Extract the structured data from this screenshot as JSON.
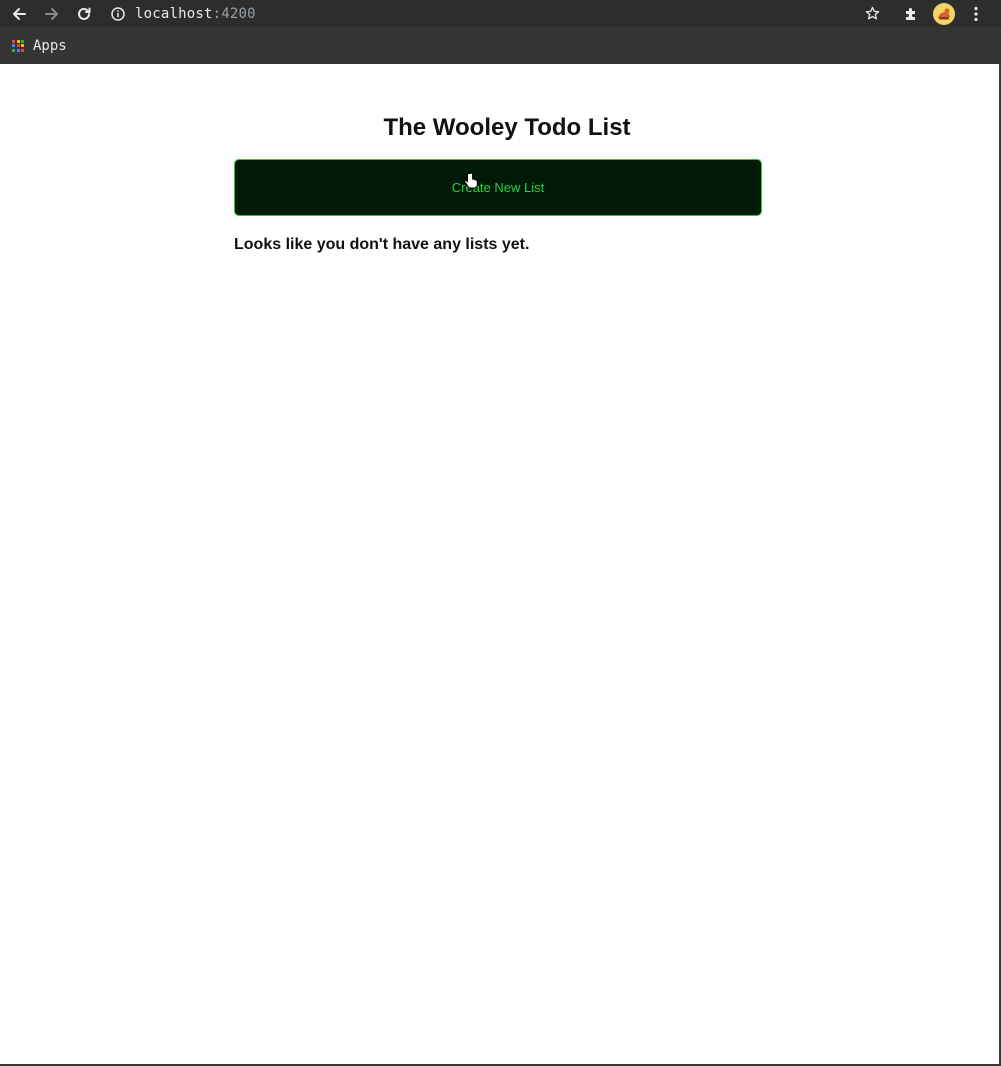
{
  "browser": {
    "url_host": "localhost",
    "url_port": ":4200",
    "icons": {
      "back": "arrow-left-icon",
      "forward": "arrow-right-icon",
      "reload": "reload-icon",
      "info": "info-icon",
      "star": "star-icon",
      "extensions": "puzzle-icon",
      "profile": "avatar",
      "menu": "kebab-menu-icon"
    },
    "bookmarks": [
      {
        "label": "Apps",
        "icon": "apps-grid-icon"
      }
    ]
  },
  "page": {
    "title": "The Wooley Todo List",
    "create_button_label": "Create New List",
    "empty_message": "Looks like you don't have any lists yet."
  },
  "colors": {
    "button_bg": "#011a07",
    "button_border": "#1bd12f",
    "button_text": "#28d13c"
  }
}
